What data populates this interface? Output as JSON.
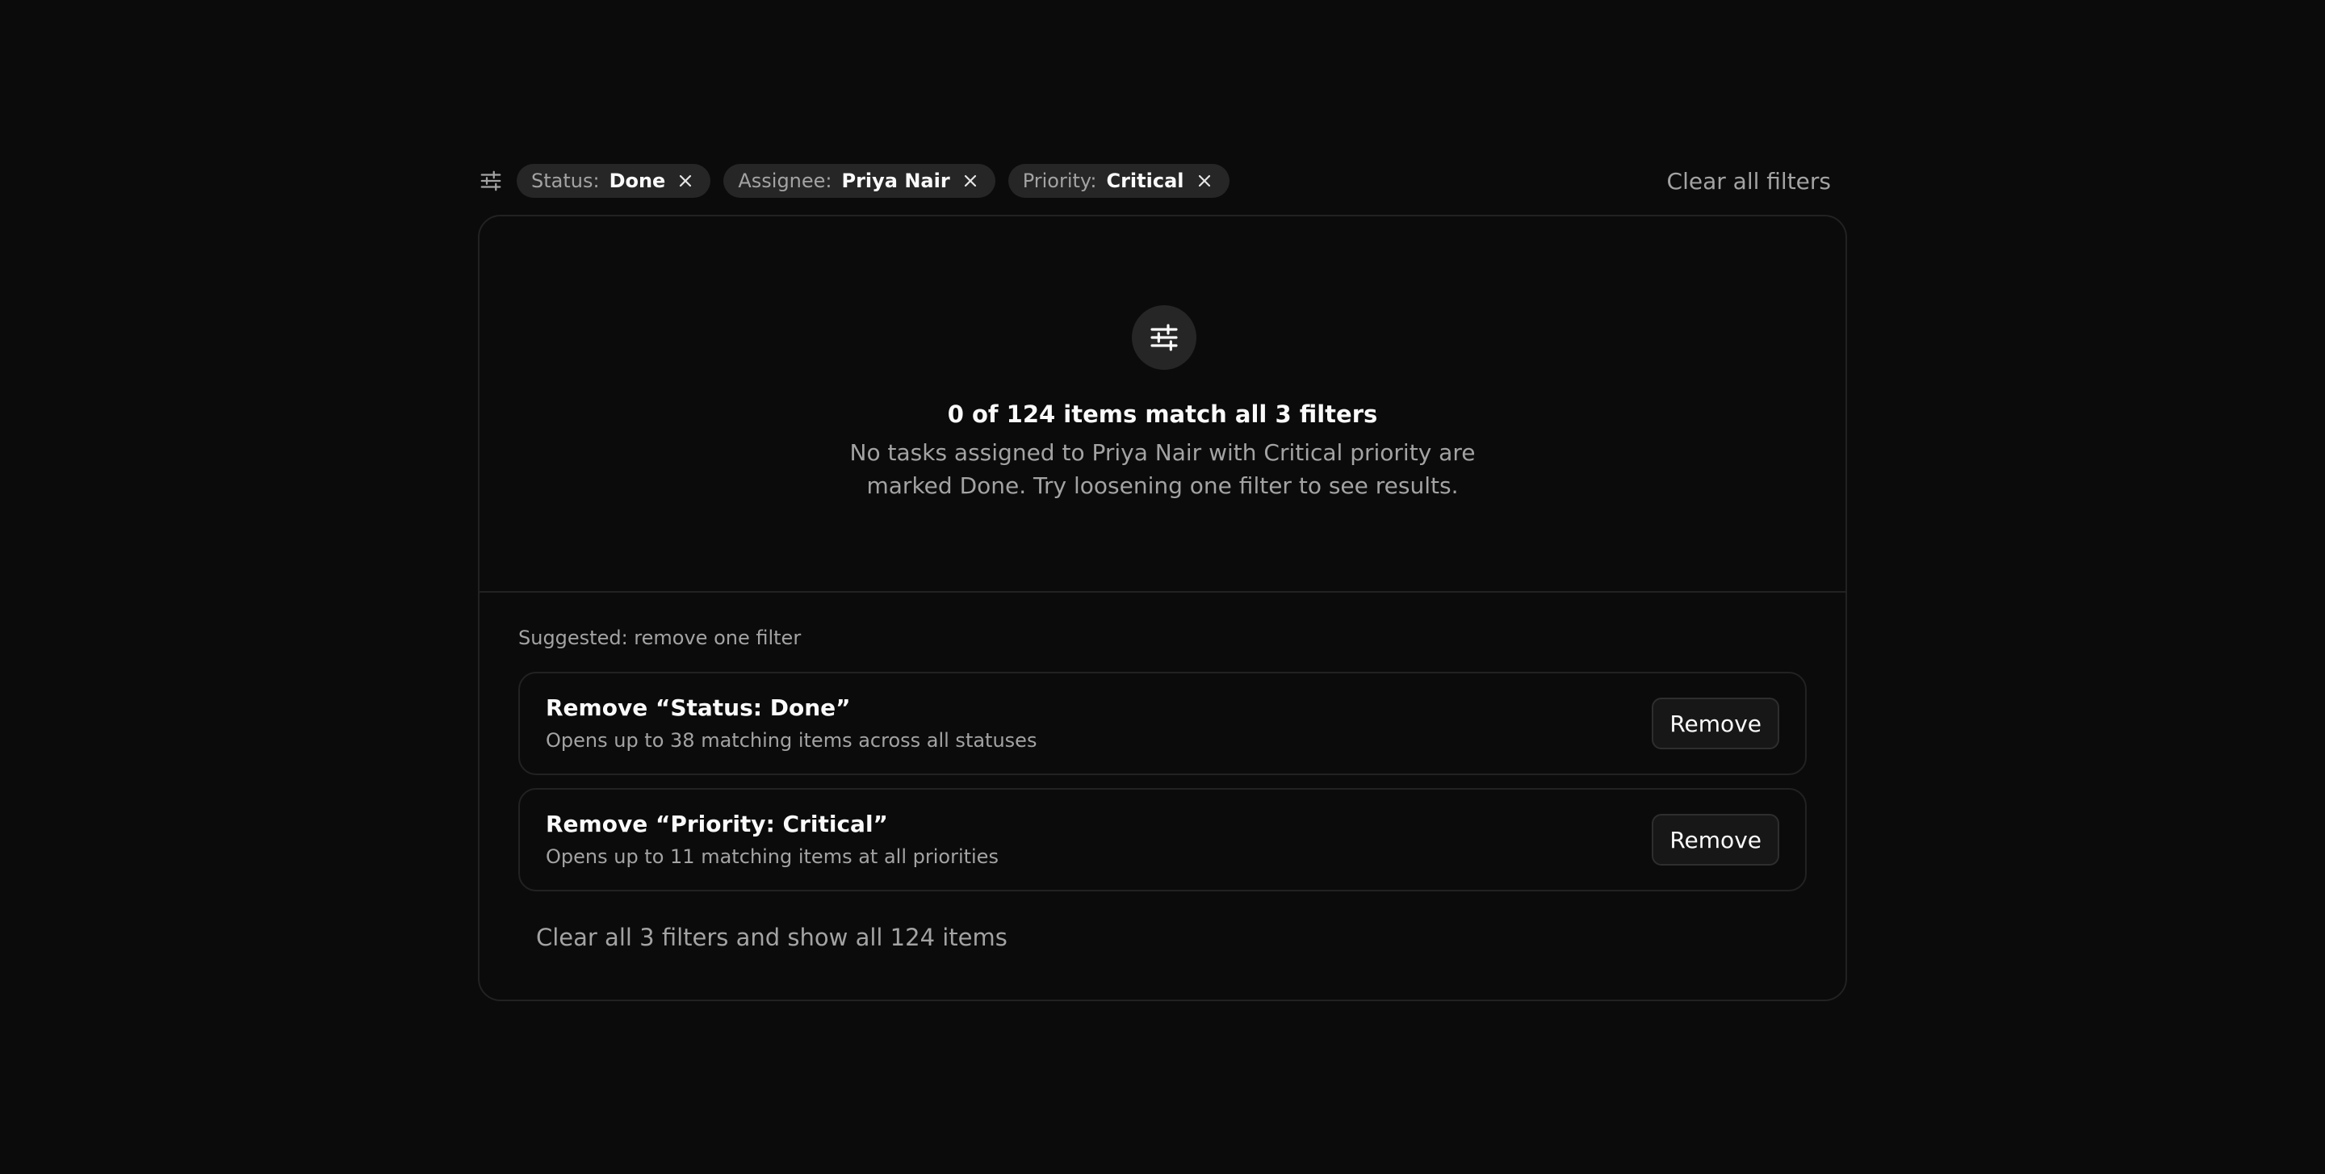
{
  "filters": {
    "chips": [
      {
        "key": "Status:",
        "value": "Done"
      },
      {
        "key": "Assignee:",
        "value": "Priya Nair"
      },
      {
        "key": "Priority:",
        "value": "Critical"
      }
    ],
    "clear_all_label": "Clear all filters",
    "icon": "sliders-icon"
  },
  "empty_state": {
    "icon": "sliders-icon",
    "title": "0 of 124 items match all 3 filters",
    "description_line1": "No tasks assigned to Priya Nair with Critical priority are",
    "description_line2": "marked Done. Try loosening one filter to see results."
  },
  "suggestions": {
    "label": "Suggested: remove one filter",
    "items": [
      {
        "title": "Remove “Status: Done”",
        "subtitle": "Opens up to 38 matching items across all statuses",
        "button": "Remove"
      },
      {
        "title": "Remove “Priority: Critical”",
        "subtitle": "Opens up to 11 matching items at all priorities",
        "button": "Remove"
      }
    ],
    "clear_link": "Clear all 3 filters and show all 124 items"
  },
  "colors": {
    "background": "#0b0b0b",
    "chip": "#262626",
    "muted_text": "#a3a3a3",
    "border": "#222222"
  }
}
